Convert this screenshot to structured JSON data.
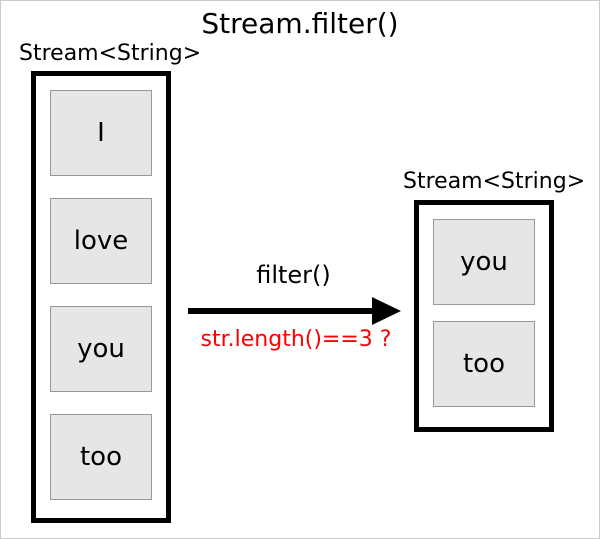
{
  "title": "Stream.filter()",
  "left": {
    "type_label": "Stream<String>",
    "items": [
      "I",
      "love",
      "you",
      "too"
    ]
  },
  "right": {
    "type_label": "Stream<String>",
    "items": [
      "you",
      "too"
    ]
  },
  "arrow": {
    "label": "filter()",
    "condition": "str.length()==3 ?",
    "condition_color": "#ff0000"
  }
}
